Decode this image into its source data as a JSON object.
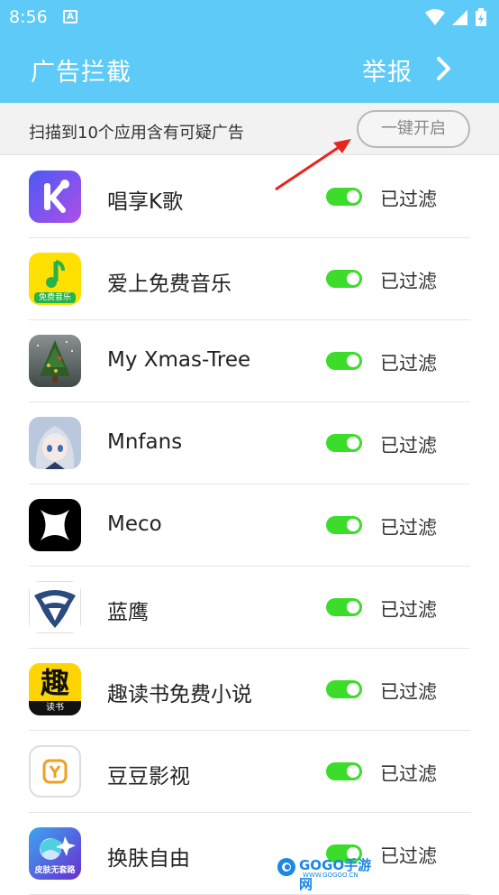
{
  "status_bar": {
    "time": "8:56",
    "notification_icon": "A"
  },
  "header": {
    "title": "广告拦截",
    "report_label": "举报"
  },
  "scan": {
    "summary": "扫描到10个应用含有可疑广告",
    "one_key_label": "一键开启"
  },
  "apps": [
    {
      "name": "唱享K歌",
      "status": "已过滤",
      "enabled": true,
      "icon": "k-song-icon",
      "color": "#6a4cf0"
    },
    {
      "name": "爱上免费音乐",
      "status": "已过滤",
      "enabled": true,
      "icon": "music-note-icon",
      "color": "#ffe000",
      "icon_caption": "免费音乐"
    },
    {
      "name": "My Xmas-Tree",
      "status": "已过滤",
      "enabled": true,
      "icon": "xmas-tree-icon",
      "color": "#5f6b6a"
    },
    {
      "name": "Mnfans",
      "status": "已过滤",
      "enabled": true,
      "icon": "anime-girl-icon",
      "color": "#8fa9c8"
    },
    {
      "name": "Meco",
      "status": "已过滤",
      "enabled": true,
      "icon": "meco-star-icon",
      "color": "#000000"
    },
    {
      "name": "蓝鹰",
      "status": "已过滤",
      "enabled": true,
      "icon": "eagle-icon",
      "color": "#2b4a7e"
    },
    {
      "name": "趣读书免费小说",
      "status": "已过滤",
      "enabled": true,
      "icon": "qu-read-icon",
      "color": "#ffd400",
      "icon_caption": "读书"
    },
    {
      "name": "豆豆影视",
      "status": "已过滤",
      "enabled": true,
      "icon": "doudou-video-icon",
      "color": "#f0a020"
    },
    {
      "name": "换肤自由",
      "status": "已过滤",
      "enabled": true,
      "icon": "skin-game-icon",
      "color": "#4a40c0",
      "icon_caption": "皮肤无套路"
    }
  ],
  "watermark": {
    "text": "GOGO手游网",
    "sub": "WWW.GOGOO.CN"
  }
}
